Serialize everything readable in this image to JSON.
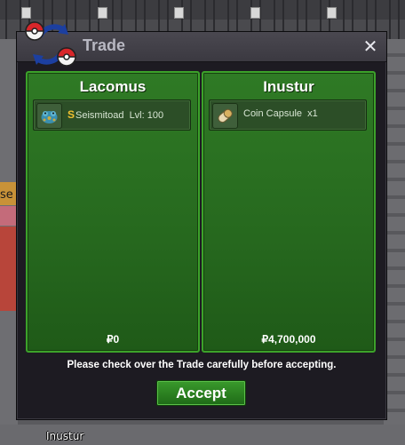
{
  "window": {
    "title": "Trade",
    "close_glyph": "✕"
  },
  "left_panel": {
    "player": "Lacomus",
    "items": [
      {
        "icon": "seismitoad-icon",
        "shiny_marker": "S",
        "name": "Seismitoad",
        "level": "Lvl: 100"
      }
    ],
    "money": "₽0"
  },
  "right_panel": {
    "player": "Inustur",
    "items": [
      {
        "icon": "coin-capsule-icon",
        "name": "Coin Capsule",
        "quantity": "x1"
      }
    ],
    "money": "₽4,700,000"
  },
  "notice": "Please check over the Trade carefully before accepting.",
  "accept_label": "Accept",
  "background": {
    "player_label": "Inustur",
    "partial_text": "se"
  },
  "colors": {
    "panel_green": "#2f7a25",
    "panel_border": "#3ca22a",
    "window_bg": "#1d1b22",
    "shiny_gold": "#f0c030"
  }
}
